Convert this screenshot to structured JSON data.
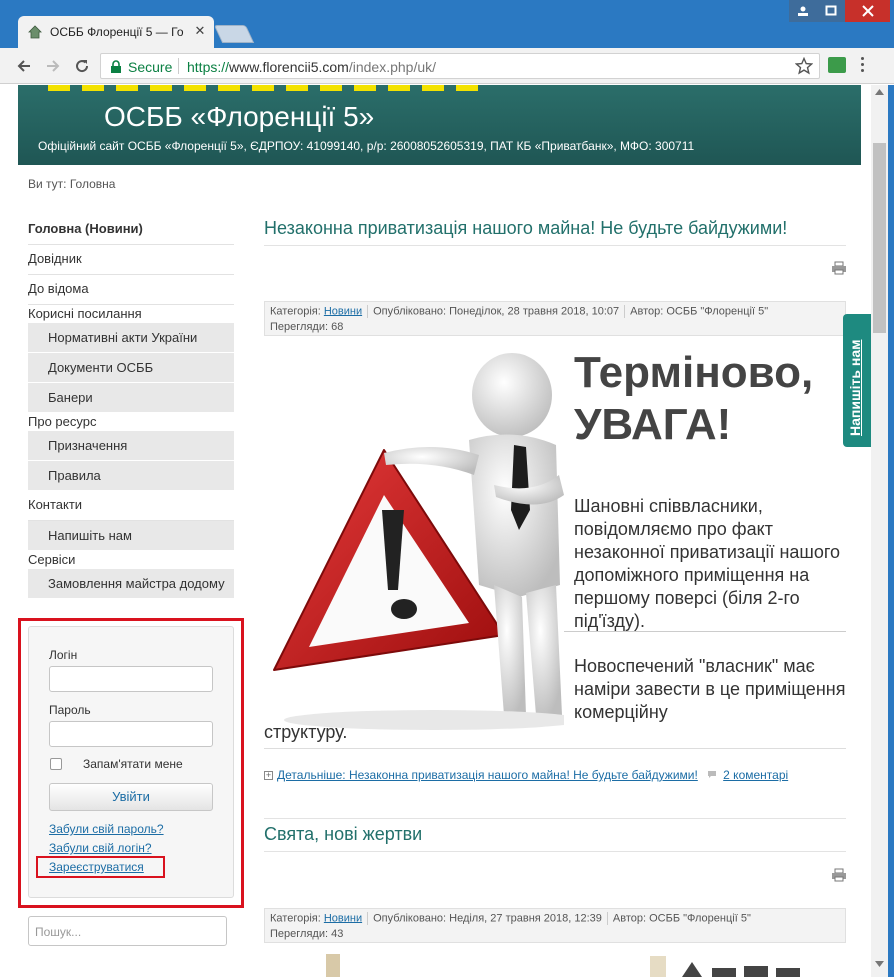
{
  "browser": {
    "tab_title": "ОСББ Флоренції 5 — Го",
    "secure_label": "Secure",
    "url_scheme": "https://",
    "url_host": "www.florencii5.com",
    "url_path": "/index.php/uk/"
  },
  "site": {
    "title": "ОСББ «Флоренції 5»",
    "subtitle": "Офіційний сайт ОСББ «Флоренції 5», ЄДРПОУ: 41099140, р/р: 26008052605319, ПАТ КБ «Приватбанк», МФО: 300711"
  },
  "breadcrumb": "Ви тут:  Головна",
  "sidebar": {
    "items": [
      {
        "label": "Головна (Новини)",
        "kind": "item",
        "active": true
      },
      {
        "label": "Довідник",
        "kind": "item"
      },
      {
        "label": "До відома",
        "kind": "item"
      },
      {
        "label": "Корисні посилання",
        "kind": "group"
      },
      {
        "label": "Нормативні акти України",
        "kind": "sub"
      },
      {
        "label": "Документи ОСББ",
        "kind": "sub"
      },
      {
        "label": "Банери",
        "kind": "sub"
      },
      {
        "label": "Про ресурс",
        "kind": "group"
      },
      {
        "label": "Призначення",
        "kind": "sub"
      },
      {
        "label": "Правила",
        "kind": "sub"
      },
      {
        "label": "Контакти",
        "kind": "item"
      },
      {
        "label": "Напишіть нам",
        "kind": "sub"
      },
      {
        "label": "Сервіси",
        "kind": "group"
      },
      {
        "label": "Замовлення майстра додому",
        "kind": "sub"
      }
    ]
  },
  "login": {
    "username_label": "Логін",
    "password_label": "Пароль",
    "remember_label": "Запам'ятати мене",
    "submit_label": "Увійти",
    "forgot_password": "Забули свій пароль?",
    "forgot_login": "Забули свій логін?",
    "register": "Зареєструватися"
  },
  "search": {
    "placeholder": "Пошук..."
  },
  "articles": [
    {
      "title": "Незаконна приватизація нашого майна! Не будьте байдужими!",
      "category_label": "Категорія:",
      "category": "Новини",
      "published": "Опубліковано: Понеділок, 28 травня 2018, 10:07",
      "author": "Автор: ОСББ \"Флоренції 5\"",
      "views": "Перегляди: 68",
      "urgent_line1": "Терміново,",
      "urgent_line2": "УВАГА!",
      "para1": "Шановні співвласники, повідомляємо про факт незаконної приватизації нашого допоміжного приміщення на першому поверсі (біля 2-го під'їзду).",
      "para2": "Новоспечений \"власник\" має наміри завести в це приміщення комерційну",
      "para_tail": "структуру.",
      "readmore": "Детальніше: Незаконна приватизація нашого майна! Не будьте байдужими!",
      "comments": "2 коментарі"
    },
    {
      "title": "Свята, нові жертви",
      "category_label": "Категорія:",
      "category": "Новини",
      "published": "Опубліковано: Неділя, 27 травня 2018, 12:39",
      "author": "Автор: ОСББ \"Флоренції 5\"",
      "views": "Перегляди: 43"
    }
  ],
  "feedback_tab": "Напишіть нам",
  "colors": {
    "accent": "#22706b",
    "header": "#1f5654",
    "link": "#1c6da5",
    "highlight": "#d9121e"
  }
}
